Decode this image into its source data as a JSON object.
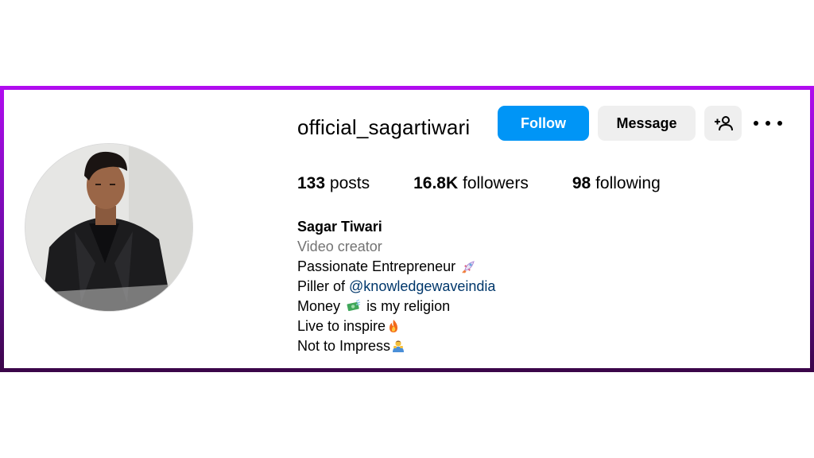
{
  "profile": {
    "username": "official_sagartiwari",
    "buttons": {
      "follow": "Follow",
      "message": "Message"
    },
    "stats": {
      "posts_count": "133",
      "posts_label": "posts",
      "followers_count": "16.8K",
      "followers_label": "followers",
      "following_count": "98",
      "following_label": "following"
    },
    "bio": {
      "name": "Sagar Tiwari",
      "category": "Video creator",
      "line1": "Passionate Entrepreneur",
      "line2_prefix": "Piller of ",
      "line2_mention": "@knowledgewaveindia",
      "line3_prefix": "Money",
      "line3_suffix": "is my religion",
      "line4": "Live to inspire",
      "line5": "Not to Impress"
    }
  },
  "icons": {
    "line1": "rocket-icon",
    "line3": "money-icon",
    "line4": "fire-icon",
    "line5": "person-bowing-icon",
    "suggest": "add-person-icon",
    "more": "more-options-icon"
  },
  "colors": {
    "follow_button": "#0095f6",
    "secondary_button": "#efefef",
    "mention": "#00376b",
    "category": "#737373",
    "frame_top": "#b10cf0",
    "frame_bottom": "#3a0648"
  }
}
